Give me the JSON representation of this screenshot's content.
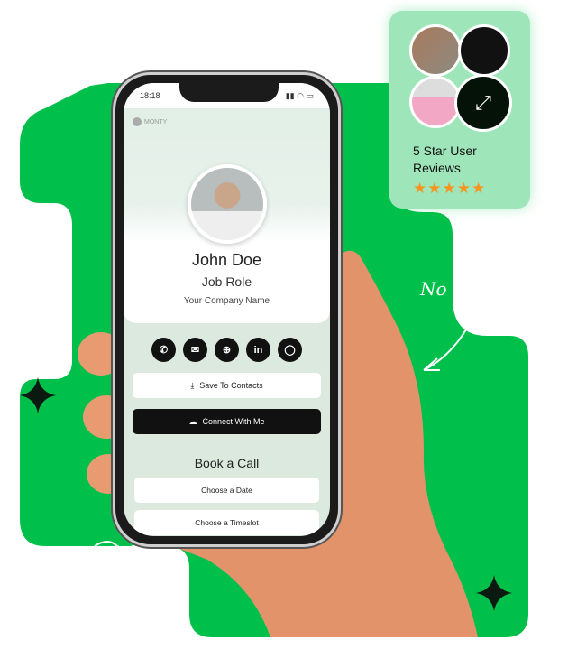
{
  "colors": {
    "brand_green": "#00c04b",
    "review_bg": "#9ee6b9",
    "star": "#f7931e"
  },
  "phone": {
    "time": "18:18",
    "logo": "MONTY",
    "profile": {
      "name": "John Doe",
      "role": "Job Role",
      "company": "Your Company Name"
    },
    "contact_icons": [
      "phone-icon",
      "mail-icon",
      "globe-icon",
      "linkedin-icon",
      "whatsapp-icon"
    ],
    "save_label": "Save To Contacts",
    "connect_label": "Connect With Me",
    "book_title": "Book a Call",
    "date_label": "Choose a Date",
    "timeslot_label": "Choose a Timeslot"
  },
  "review": {
    "line1": "5 Star User",
    "line2": "Reviews",
    "stars": "★★★★★",
    "rating": 5
  },
  "handwriting": "No"
}
